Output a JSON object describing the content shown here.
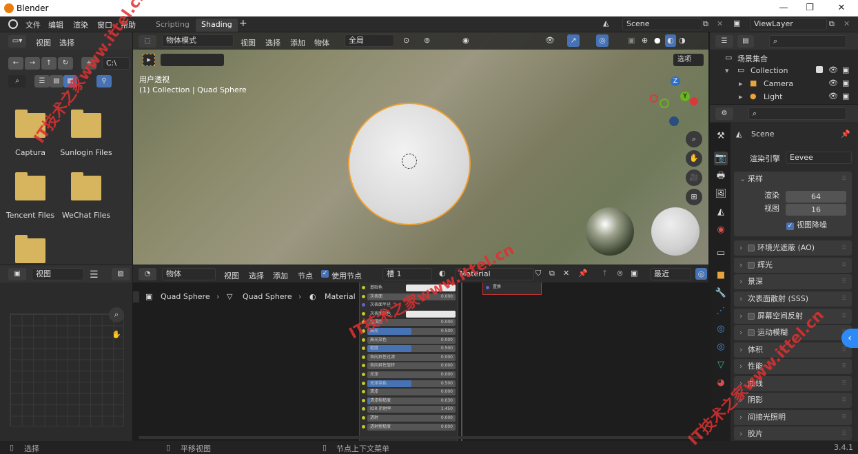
{
  "window": {
    "title": "Blender",
    "controls": [
      "—",
      "❐",
      "✕"
    ]
  },
  "topbar": {
    "menus": [
      "文件",
      "编辑",
      "渲染",
      "窗口",
      "帮助"
    ],
    "tabs": [
      "Scripting",
      "Shading"
    ],
    "active_tab": "Shading",
    "add_tab": "+",
    "scene": "Scene",
    "view_layer": "ViewLayer"
  },
  "filebrowser": {
    "menus": [
      "视图",
      "选择"
    ],
    "path": "C:\\",
    "folders": [
      "Captura",
      "Sunlogin Files",
      "Tencent Files",
      "WeChat Files"
    ]
  },
  "viewport": {
    "mode": "物体模式",
    "menus": [
      "视图",
      "选择",
      "添加",
      "物体"
    ],
    "transform": "全局",
    "options": "选项",
    "view_label": "用户透视",
    "collection_label": "(1) Collection | Quad Sphere",
    "gizmo": {
      "z": "Z",
      "y": "Y"
    }
  },
  "outliner": {
    "root": "场景集合",
    "items": [
      "Collection",
      "Camera",
      "Light"
    ]
  },
  "image_editor": {
    "view": "视图"
  },
  "node_editor": {
    "type": "物体",
    "menus": [
      "视图",
      "选择",
      "添加",
      "节点"
    ],
    "use_nodes": "使用节点",
    "slot": "槽 1",
    "material": "Material",
    "recent": "最近",
    "breadcrumb": [
      "Quad Sphere",
      "Quad Sphere",
      "Material"
    ],
    "node_rows": [
      {
        "label": "基础色",
        "value": "",
        "fill": 0,
        "kind": "color"
      },
      {
        "label": "次表面",
        "value": "0.000",
        "fill": 0,
        "kind": "value"
      },
      {
        "label": "次表面半径",
        "value": "",
        "fill": 0,
        "kind": "select"
      },
      {
        "label": "次表面颜色",
        "value": "",
        "fill": 0,
        "kind": "color"
      },
      {
        "label": "金属度",
        "value": "0.000",
        "fill": 0,
        "kind": "value"
      },
      {
        "label": "高光",
        "value": "0.500",
        "fill": 0.5,
        "kind": "value"
      },
      {
        "label": "高光染色",
        "value": "0.000",
        "fill": 0,
        "kind": "value"
      },
      {
        "label": "糙度",
        "value": "0.500",
        "fill": 0.5,
        "kind": "value"
      },
      {
        "label": "各向异性过滤",
        "value": "0.000",
        "fill": 0,
        "kind": "value"
      },
      {
        "label": "各向异性旋转",
        "value": "0.000",
        "fill": 0,
        "kind": "value"
      },
      {
        "label": "光泽",
        "value": "0.000",
        "fill": 0,
        "kind": "value"
      },
      {
        "label": "光泽染色",
        "value": "0.500",
        "fill": 0.5,
        "kind": "value"
      },
      {
        "label": "清漆",
        "value": "0.000",
        "fill": 0,
        "kind": "value"
      },
      {
        "label": "清漆粗糙度",
        "value": "0.030",
        "fill": 0.03,
        "kind": "value"
      },
      {
        "label": "IOR 折射率",
        "value": "1.450",
        "fill": 0,
        "kind": "value"
      },
      {
        "label": "透射",
        "value": "0.000",
        "fill": 0,
        "kind": "value"
      },
      {
        "label": "透射粗糙度",
        "value": "0.000",
        "fill": 0,
        "kind": "value"
      }
    ],
    "output_node": "置换"
  },
  "properties": {
    "scene_name": "Scene",
    "render_engine_label": "渲染引擎",
    "render_engine": "Eevee",
    "sampling": {
      "title": "采样",
      "render_label": "渲染",
      "render_value": "64",
      "viewport_label": "视图",
      "viewport_value": "16",
      "denoise_label": "视图降噪"
    },
    "sections": [
      "环境光遮蔽 (AO)",
      "辉光",
      "景深",
      "次表面散射 (SSS)",
      "屏幕空间反射",
      "运动模糊",
      "体积",
      "性能",
      "曲线",
      "阴影",
      "间接光照明",
      "胶片"
    ]
  },
  "status": {
    "select": "选择",
    "pan": "平移视图",
    "context": "节点上下文菜单",
    "version": "3.4.1"
  },
  "watermarks": [
    "IT技术之家www.ittel.cn",
    "IT技术之家www.ittel.cn",
    "IT技术之家www.ittel.cn"
  ]
}
